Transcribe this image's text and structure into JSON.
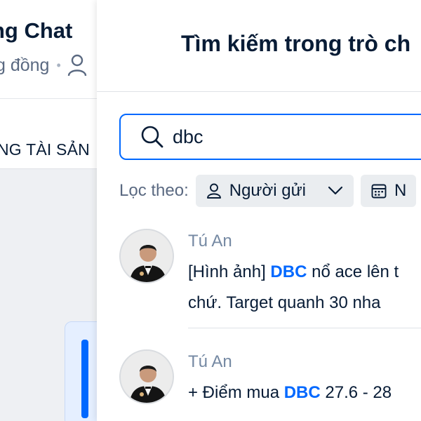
{
  "background_chat": {
    "title_fragment": "ng Chat",
    "subtitle_fragment": "g đồng",
    "separator": "•",
    "pinned_fragment": "NG TÀI SẢN"
  },
  "search_panel": {
    "title": "Tìm kiếm trong trò ch",
    "search": {
      "value": "dbc",
      "icon": "search-icon"
    },
    "filter": {
      "label": "Lọc theo:",
      "sender_chip": "Người gửi",
      "date_chip": "N"
    },
    "results": [
      {
        "sender": "Tú An",
        "line1_before": "[Hình ảnh] ",
        "line1_match": "DBC",
        "line1_after": " nổ ace lên t",
        "line2": "chứ. Target quanh 30 nha"
      },
      {
        "sender": "Tú An",
        "line1_before": "+ Điểm mua ",
        "line1_match": "DBC",
        "line1_after": " 27.6 - 28"
      }
    ]
  },
  "colors": {
    "accent": "#0068ff",
    "text_primary": "#081c36",
    "text_secondary": "#7589a3",
    "chip_bg": "#eaedf0"
  }
}
